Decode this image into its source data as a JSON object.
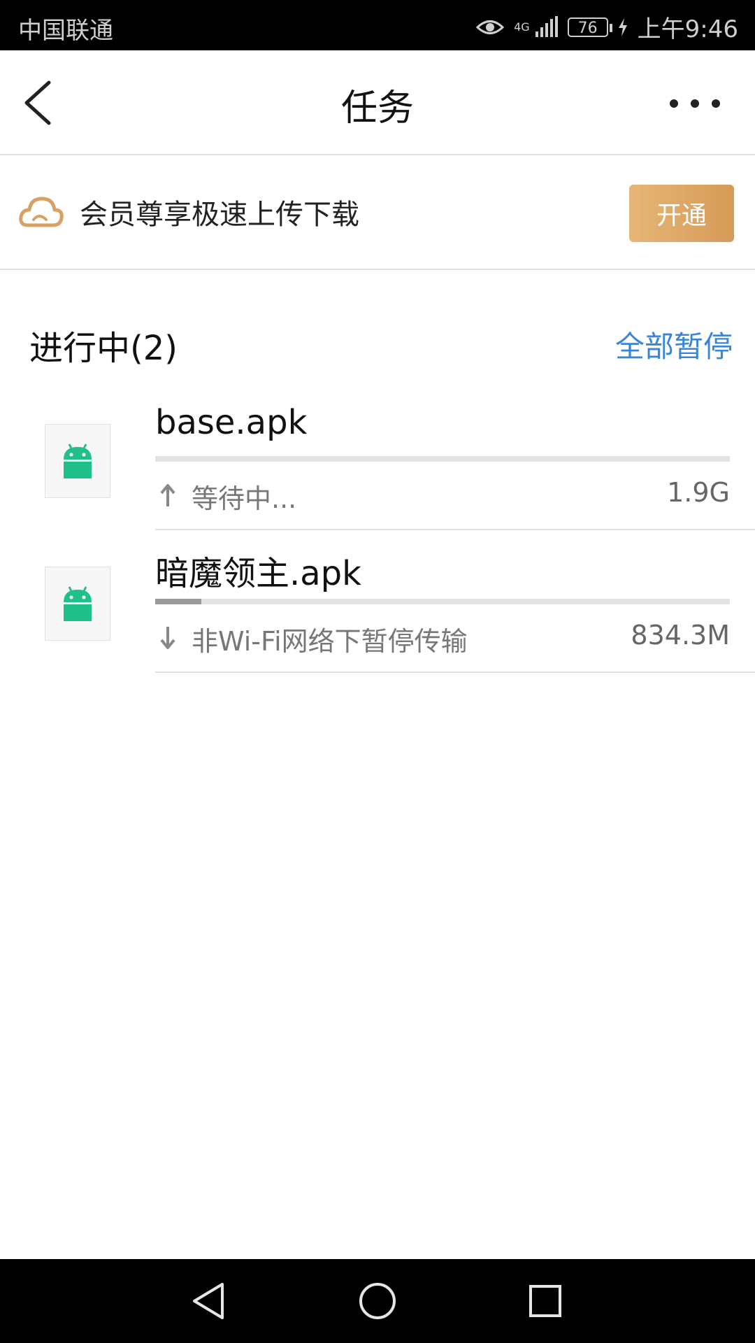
{
  "status_bar": {
    "carrier": "中国联通",
    "network": "4G",
    "battery": "76",
    "time": "上午9:46"
  },
  "header": {
    "title": "任务"
  },
  "promo": {
    "text": "会员尊享极速上传下载",
    "button_label": "开通",
    "accent_color": "#d8a062"
  },
  "section": {
    "title": "进行中(2)",
    "action_label": "全部暂停",
    "action_color": "#3a86d6"
  },
  "tasks": [
    {
      "name": "base.apk",
      "status": "等待中...",
      "size": "1.9G",
      "direction": "upload",
      "progress": 0.0
    },
    {
      "name": "暗魔领主.apk",
      "status": "非Wi-Fi网络下暂停传输",
      "size": "834.3M",
      "direction": "download",
      "progress": 0.08
    }
  ],
  "icons": {
    "back": "back-chevron-icon",
    "more": "more-dots-icon",
    "promo": "cloud-icon",
    "file": "android-icon",
    "android_color": "#20c08a"
  }
}
